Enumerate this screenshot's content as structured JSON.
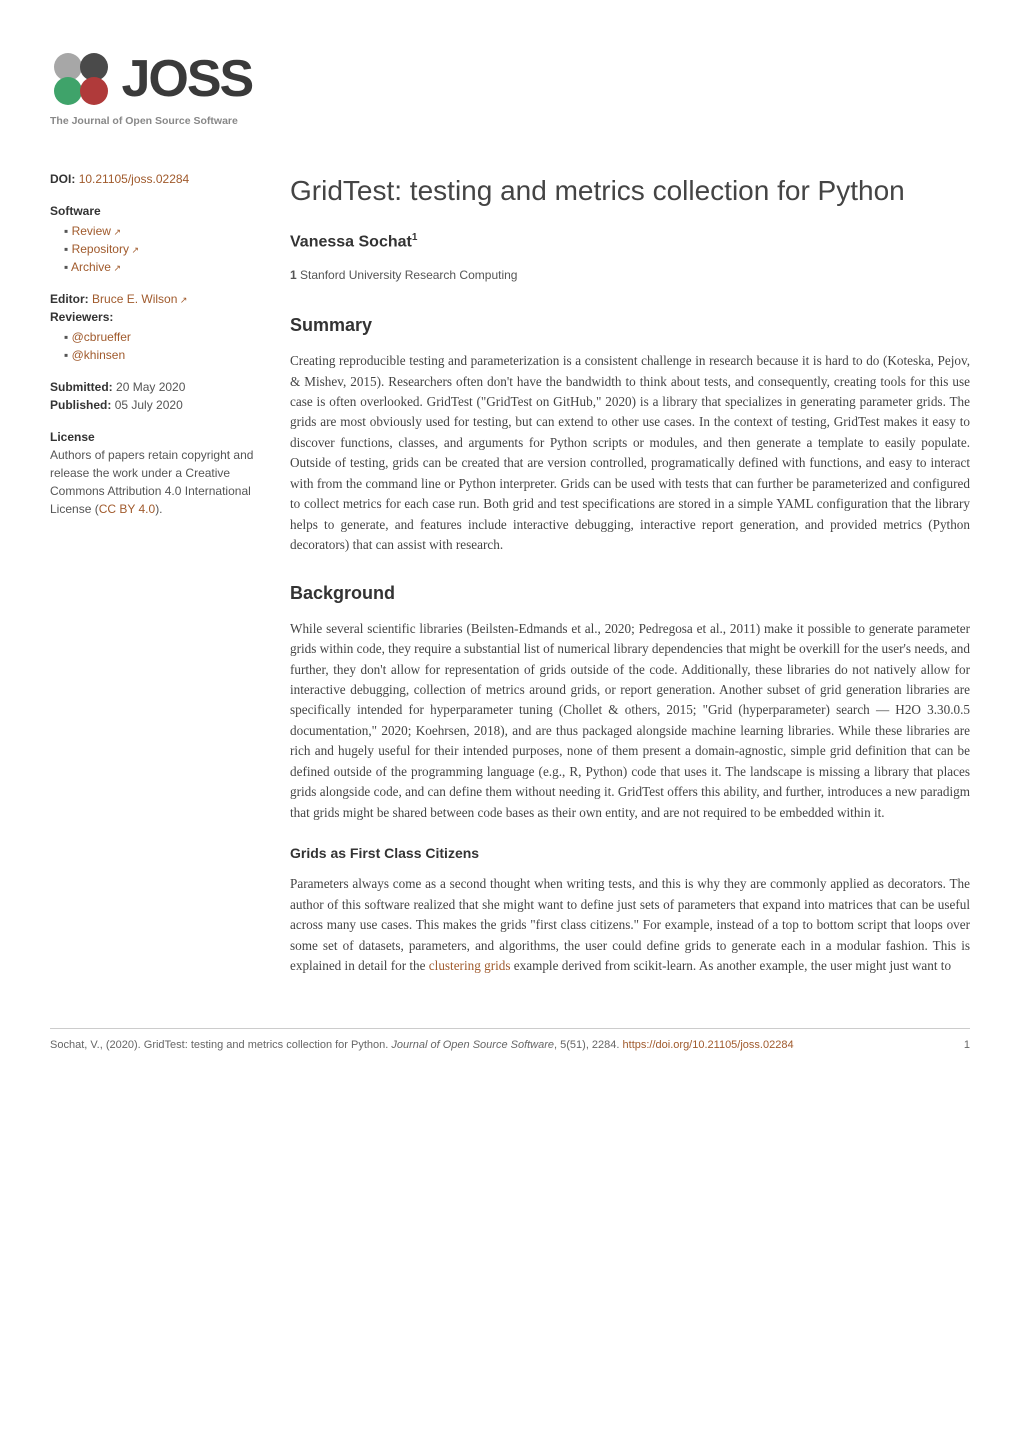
{
  "logo": {
    "text": "JOSS",
    "tagline": "The Journal of Open Source Software"
  },
  "sidebar": {
    "doi_label": "DOI:",
    "doi_value": "10.21105/joss.02284",
    "software_header": "Software",
    "software_items": [
      {
        "label": "Review"
      },
      {
        "label": "Repository"
      },
      {
        "label": "Archive"
      }
    ],
    "editor_label": "Editor:",
    "editor_name": "Bruce E. Wilson",
    "reviewers_label": "Reviewers:",
    "reviewers": [
      {
        "handle": "@cbrueffer"
      },
      {
        "handle": "@khinsen"
      }
    ],
    "submitted_label": "Submitted:",
    "submitted_date": "20 May 2020",
    "published_label": "Published:",
    "published_date": "05 July 2020",
    "license_label": "License",
    "license_text_1": "Authors of papers retain copyright and release the work under a Creative Commons Attribution 4.0 International License (",
    "license_link": "CC BY 4.0",
    "license_text_2": ")."
  },
  "main": {
    "title": "GridTest: testing and metrics collection for Python",
    "author": "Vanessa Sochat",
    "author_sup": "1",
    "affiliation_num": "1",
    "affiliation_text": "Stanford University Research Computing",
    "summary_heading": "Summary",
    "summary_body": "Creating reproducible testing and parameterization is a consistent challenge in research because it is hard to do (Koteska, Pejov, & Mishev, 2015). Researchers often don't have the bandwidth to think about tests, and consequently, creating tools for this use case is often overlooked. GridTest (\"GridTest on GitHub,\" 2020) is a library that specializes in generating parameter grids. The grids are most obviously used for testing, but can extend to other use cases. In the context of testing, GridTest makes it easy to discover functions, classes, and arguments for Python scripts or modules, and then generate a template to easily populate. Outside of testing, grids can be created that are version controlled, programatically defined with functions, and easy to interact with from the command line or Python interpreter. Grids can be used with tests that can further be parameterized and configured to collect metrics for each case run. Both grid and test specifications are stored in a simple YAML configuration that the library helps to generate, and features include interactive debugging, interactive report generation, and provided metrics (Python decorators) that can assist with research.",
    "background_heading": "Background",
    "background_body": "While several scientific libraries (Beilsten-Edmands et al., 2020; Pedregosa et al., 2011) make it possible to generate parameter grids within code, they require a substantial list of numerical library dependencies that might be overkill for the user's needs, and further, they don't allow for representation of grids outside of the code. Additionally, these libraries do not natively allow for interactive debugging, collection of metrics around grids, or report generation. Another subset of grid generation libraries are specifically intended for hyperparameter tuning (Chollet & others, 2015; \"Grid (hyperparameter) search — H2O 3.30.0.5 documentation,\" 2020; Koehrsen, 2018), and are thus packaged alongside machine learning libraries. While these libraries are rich and hugely useful for their intended purposes, none of them present a domain-agnostic, simple grid definition that can be defined outside of the programming language (e.g., R, Python) code that uses it. The landscape is missing a library that places grids alongside code, and can define them without needing it. GridTest offers this ability, and further, introduces a new paradigm that grids might be shared between code bases as their own entity, and are not required to be embedded within it.",
    "grids_heading": "Grids as First Class Citizens",
    "grids_body_1": "Parameters always come as a second thought when writing tests, and this is why they are commonly applied as decorators. The author of this software realized that she might want to define just sets of parameters that expand into matrices that can be useful across many use cases. This makes the grids \"first class citizens.\" For example, instead of a top to bottom script that loops over some set of datasets, parameters, and algorithms, the user could define grids to generate each in a modular fashion. This is explained in detail for the ",
    "grids_link": "clustering grids",
    "grids_body_2": " example derived from scikit-learn. As another example, the user might just want to"
  },
  "footer": {
    "citation_prefix": "Sochat, V., (2020). GridTest: testing and metrics collection for Python. ",
    "journal": "Journal of Open Source Software",
    "citation_suffix": ", 5(51), 2284. ",
    "doi_url": "https://doi.org/10.21105/joss.02284",
    "page_num": "1"
  }
}
